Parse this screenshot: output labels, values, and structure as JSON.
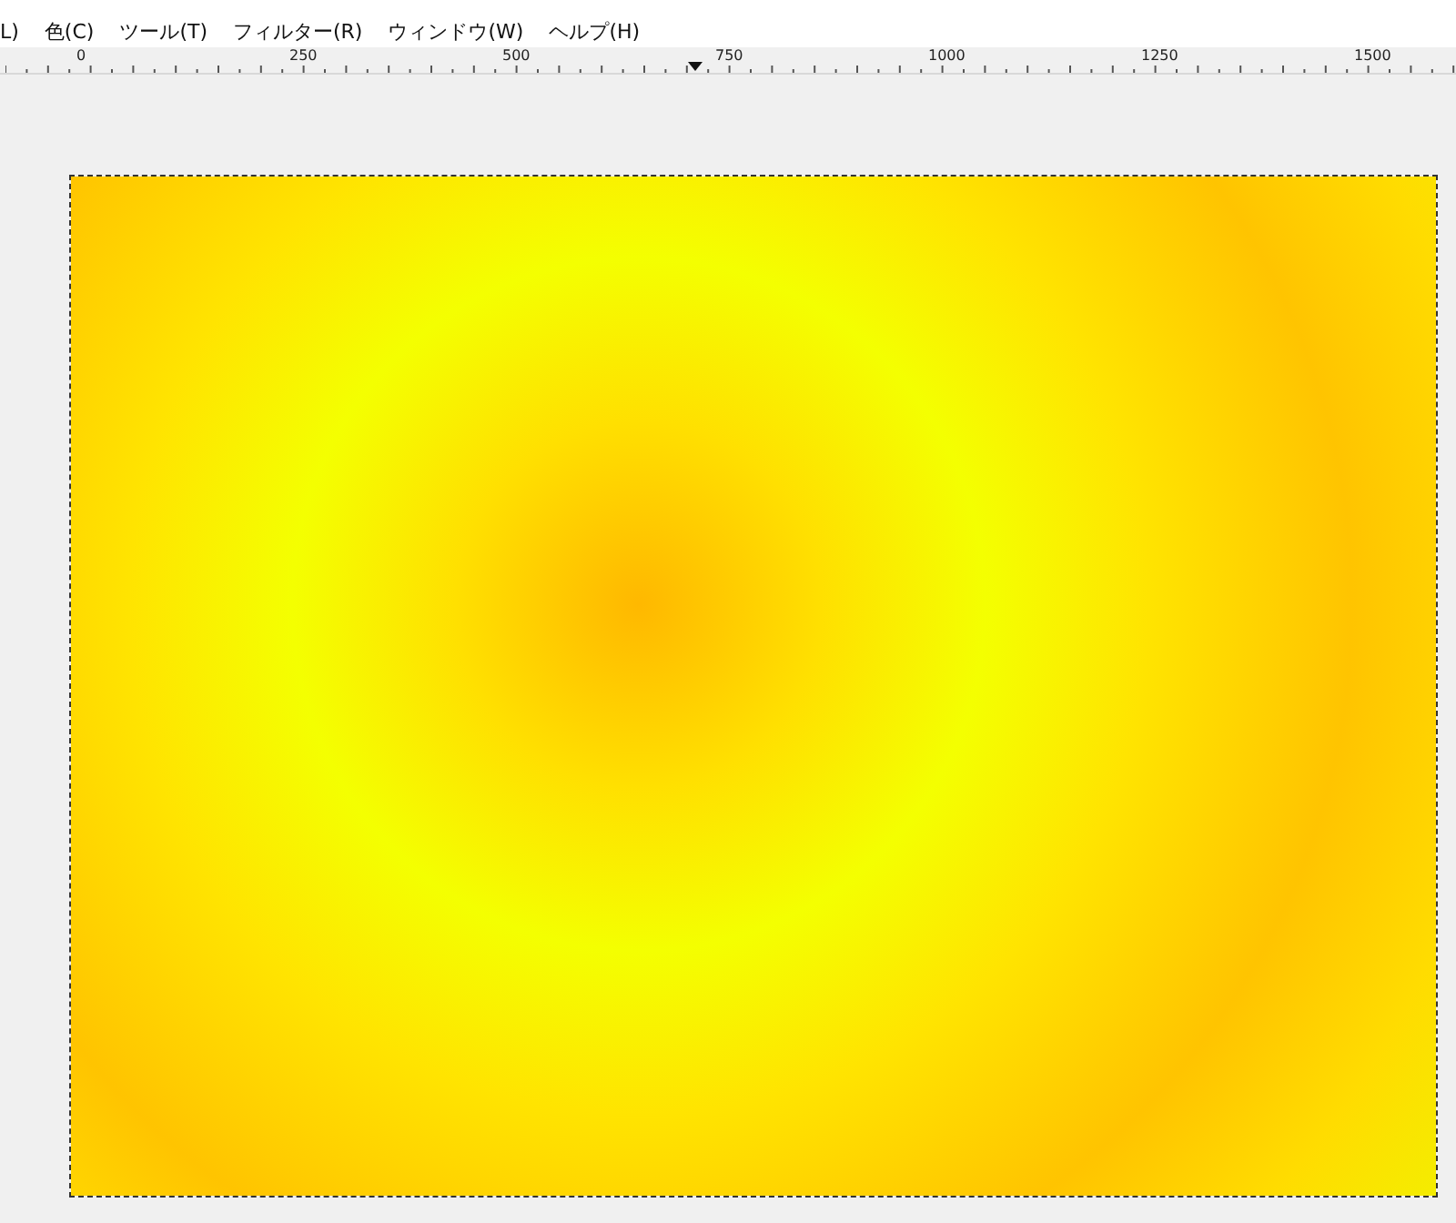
{
  "menu": [
    {
      "label": "L)"
    },
    {
      "label": "色(C)"
    },
    {
      "label": "ツール(T)"
    },
    {
      "label": "フィルター(R)"
    },
    {
      "label": "ウィンドウ(W)"
    },
    {
      "label": "ヘルプ(H)"
    }
  ],
  "ruler": {
    "labels": [
      "0",
      "250",
      "500",
      "750",
      "1000",
      "1250",
      "1500"
    ]
  }
}
